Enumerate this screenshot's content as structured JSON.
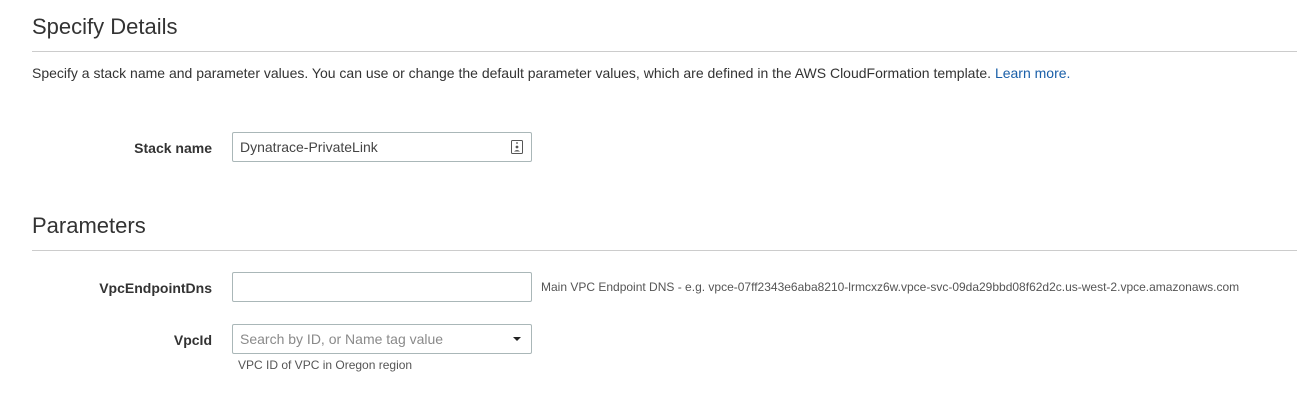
{
  "details": {
    "title": "Specify Details",
    "description": "Specify a stack name and parameter values. You can use or change the default parameter values, which are defined in the AWS CloudFormation template.",
    "learn_more": "Learn more.",
    "stack_name": {
      "label": "Stack name",
      "value": "Dynatrace-PrivateLink"
    }
  },
  "parameters": {
    "title": "Parameters",
    "vpc_endpoint_dns": {
      "label": "VpcEndpointDns",
      "value": "",
      "hint": "Main VPC Endpoint DNS - e.g. vpce-07ff2343e6aba8210-lrmcxz6w.vpce-svc-09da29bbd08f62d2c.us-west-2.vpce.amazonaws.com"
    },
    "vpc_id": {
      "label": "VpcId",
      "placeholder": "Search by ID, or Name tag value",
      "hint": "VPC ID of VPC in Oregon region"
    }
  },
  "icons": {
    "stack_name_field": "contact-card-icon",
    "vpc_dropdown": "caret-down-icon"
  },
  "colors": {
    "link": "#1a5fa8",
    "rule": "#cccccc",
    "input_border": "#aab7b8"
  }
}
